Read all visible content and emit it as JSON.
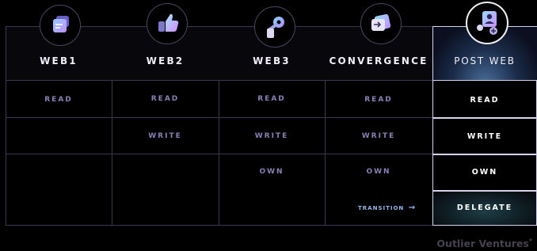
{
  "columns": [
    {
      "header": "WEB1",
      "icon": "stacked-cards-icon"
    },
    {
      "header": "WEB2",
      "icon": "thumbs-up-icon"
    },
    {
      "header": "WEB3",
      "icon": "key-icon"
    },
    {
      "header": "CONVERGENCE",
      "icon": "arrow-card-icon"
    },
    {
      "header": "POST WEB",
      "icon": "user-group-icon"
    }
  ],
  "rows": {
    "web1": [
      "READ"
    ],
    "web2": [
      "READ",
      "WRITE"
    ],
    "web3": [
      "READ",
      "WRITE",
      "OWN"
    ],
    "convergence": [
      "READ",
      "WRITE",
      "OWN"
    ],
    "post_web": [
      "READ",
      "WRITE",
      "OWN",
      "DELEGATE"
    ]
  },
  "transition_label": "TRANSITION",
  "transition_arrow": "→",
  "brand": "Outlier Ventures",
  "brand_mark": "*",
  "colors": {
    "background": "#000000",
    "grid_line": "#3a3550",
    "muted_label": "#8b7fb4",
    "highlight_border": "#d8d2ee",
    "transition_text": "#8fb8ea",
    "brand_text": "#45414e"
  }
}
